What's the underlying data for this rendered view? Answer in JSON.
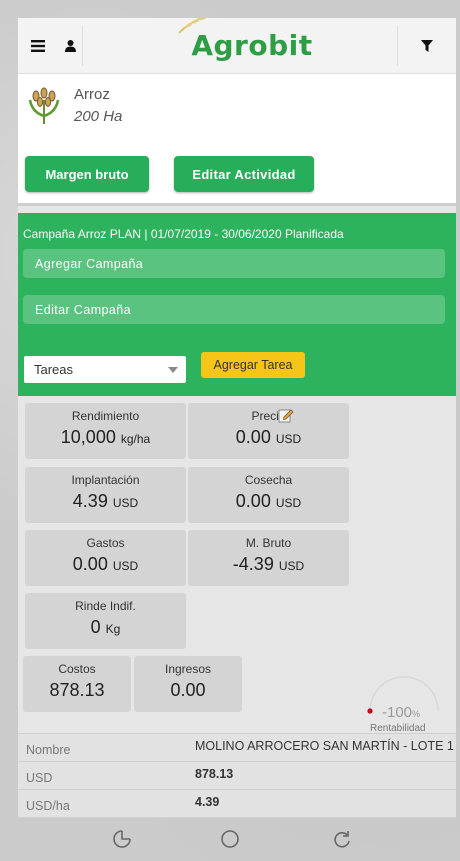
{
  "header": {
    "menu_icon": "hamburger-icon",
    "user_icon": "user-icon",
    "filter_icon": "filter-icon",
    "logo_text": "Agrobit"
  },
  "crop": {
    "icon": "rice-plant-icon",
    "name": "Arroz",
    "area": "200 Ha",
    "margin_button": "Margen bruto",
    "edit_button": "Editar Actividad"
  },
  "campaign": {
    "line": "Campaña  Arroz PLAN | 01/07/2019 - 30/06/2020  Planificada",
    "add_label": "Agregar Campaña",
    "edit_label": "Editar Campaña",
    "task_select_value": "Tareas",
    "add_task_button": "Agregar Tarea"
  },
  "metrics": {
    "rendimiento": {
      "label": "Rendimiento",
      "value": "10,000",
      "unit": "kg/ha"
    },
    "precio": {
      "label": "Precio",
      "value": "0.00",
      "unit": "USD",
      "edit_icon": "pencil-icon"
    },
    "implantacion": {
      "label": "Implantación",
      "value": "4.39",
      "unit": "USD"
    },
    "cosecha": {
      "label": "Cosecha",
      "value": "0.00",
      "unit": "USD"
    },
    "gastos": {
      "label": "Gastos",
      "value": "0.00",
      "unit": "USD"
    },
    "mbruto": {
      "label": "M. Bruto",
      "value": "-4.39",
      "unit": "USD"
    },
    "rinde": {
      "label": "Rinde Indif.",
      "value": "0",
      "unit": "Kg"
    },
    "costos": {
      "label": "Costos",
      "value": "878.13"
    },
    "ingresos": {
      "label": "Ingresos",
      "value": "0.00"
    }
  },
  "rentabilidad": {
    "value": "-100",
    "unit": "%",
    "label": "Rentabilidad",
    "accent_color": "#d0021b"
  },
  "table": {
    "rows": [
      {
        "key": "Nombre",
        "value": "MOLINO ARROCERO SAN MARTÍN - LOTE 1"
      },
      {
        "key": "USD",
        "value": "878.13"
      },
      {
        "key": "USD/ha",
        "value": "4.39"
      }
    ]
  },
  "nav": {
    "left_icon": "pie-chart-icon",
    "center_icon": "circle-home-icon",
    "right_icon": "refresh-icon"
  },
  "colors": {
    "brand_green": "#2db35d",
    "button_green": "#27ae5a",
    "accent_yellow": "#f5c518"
  }
}
